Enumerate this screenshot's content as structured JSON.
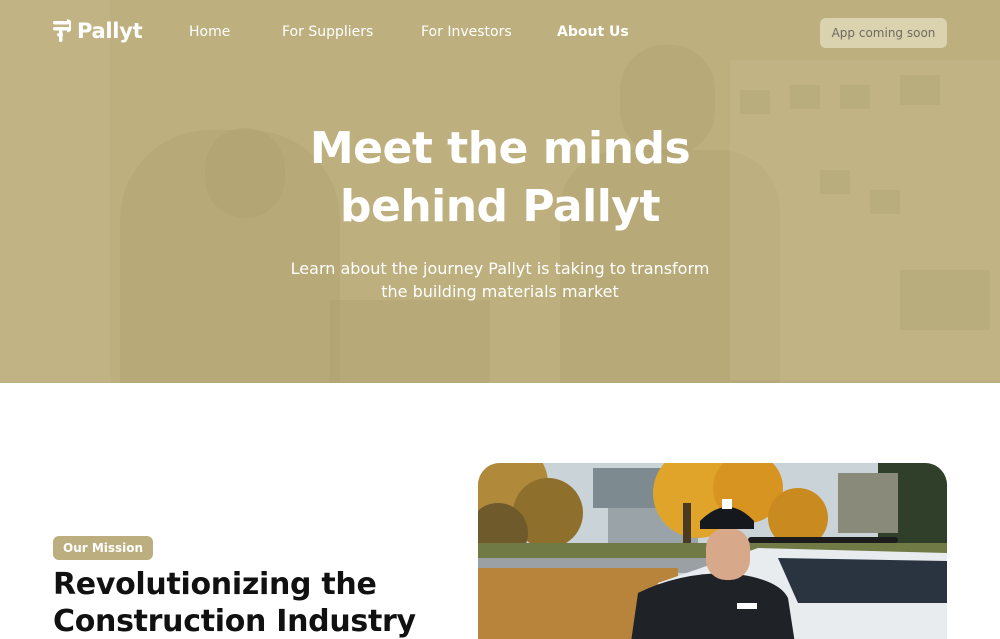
{
  "brand": {
    "name": "Pallyt"
  },
  "nav": {
    "items": [
      {
        "label": "Home"
      },
      {
        "label": "For Suppliers"
      },
      {
        "label": "For Investors"
      },
      {
        "label": "About Us",
        "active": true
      }
    ],
    "cta_label": "App coming soon"
  },
  "hero": {
    "title_line1": "Meet the minds",
    "title_line2": "behind Pallyt",
    "subtitle_line1": "Learn about the journey Pallyt is taking to transform",
    "subtitle_line2": "the building materials market"
  },
  "mission": {
    "badge": "Our Mission",
    "title_line1": "Revolutionizing the",
    "title_line2": "Construction Industry"
  },
  "colors": {
    "accent": "#bcae7e",
    "text_dark": "#111111",
    "white": "#ffffff"
  },
  "icons": {
    "logo": "pallyt-logo-icon"
  }
}
